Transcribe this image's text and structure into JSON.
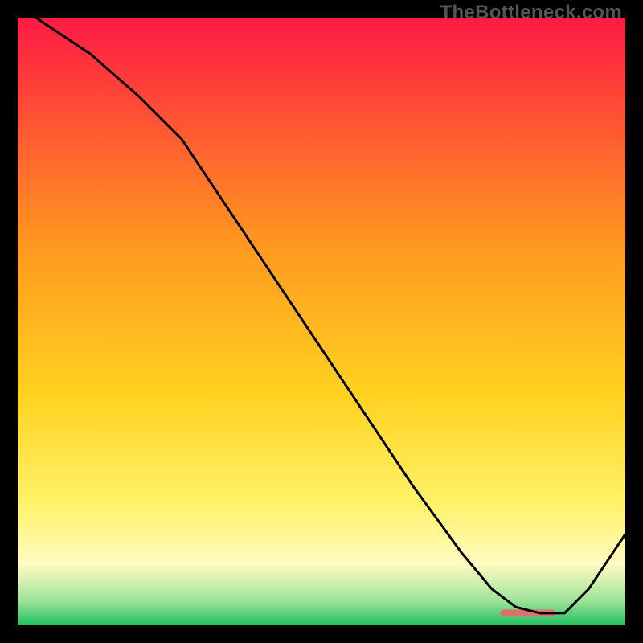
{
  "watermark": "TheBottleneck.com",
  "chart_data": {
    "type": "line",
    "title": "",
    "xlabel": "",
    "ylabel": "",
    "xlim": [
      0,
      100
    ],
    "ylim": [
      0,
      100
    ],
    "grid": false,
    "legend": false,
    "background_gradient_stops": [
      {
        "offset": 0.0,
        "color": "#ff1a44"
      },
      {
        "offset": 0.38,
        "color": "#ff9a1f"
      },
      {
        "offset": 0.62,
        "color": "#ffd21f"
      },
      {
        "offset": 0.8,
        "color": "#fff26a"
      },
      {
        "offset": 0.9,
        "color": "#fffbc2"
      },
      {
        "offset": 0.96,
        "color": "#9de39a"
      },
      {
        "offset": 1.0,
        "color": "#20c060"
      }
    ],
    "series": [
      {
        "name": "curve",
        "x": [
          3,
          12,
          20,
          27,
          35,
          45,
          55,
          65,
          73,
          78,
          82,
          86,
          90,
          94,
          100
        ],
        "y": [
          100,
          94,
          87,
          80,
          68,
          53,
          38,
          23,
          12,
          6,
          3,
          2,
          2,
          6,
          15
        ]
      }
    ],
    "marker_band": {
      "x": [
        80,
        88
      ],
      "y": 2,
      "color": "#e07070"
    }
  }
}
